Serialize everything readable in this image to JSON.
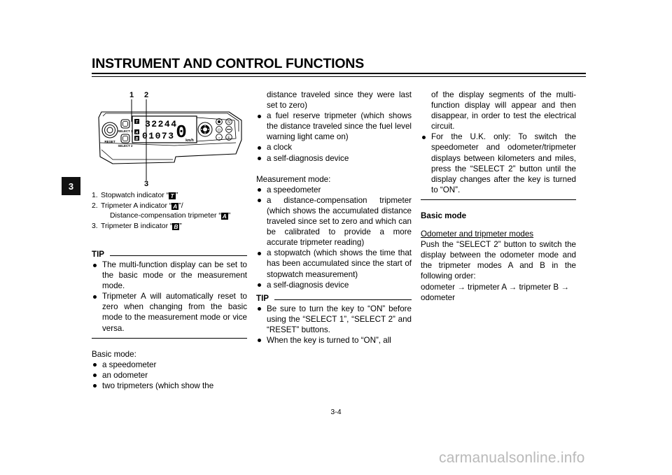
{
  "header": {
    "chapter_title": "INSTRUMENT AND CONTROL FUNCTIONS"
  },
  "margin_tab": {
    "chapter_number": "3"
  },
  "figure": {
    "callouts": [
      "1",
      "2",
      "3"
    ],
    "lcd": {
      "top_value": "32244",
      "bottom_value": "01073",
      "speed_value": "0",
      "speed_unit": "km/h",
      "indicator_top": "T",
      "indicator_mid": "A",
      "indicator_bottom": "B"
    },
    "buttons": {
      "reset_label": "RESET",
      "select1_label": "SELECT 1",
      "select2_label": "SELECT 2"
    }
  },
  "legend": {
    "item1_num": "1.",
    "item1_text_before": "Stopwatch indicator “",
    "item1_glyph": "T",
    "item1_text_after": "”",
    "item2_num": "2.",
    "item2_text_before": "Tripmeter A indicator “",
    "item2_glyph": "A",
    "item2_text_after": "”/",
    "item2_sub_before": "Distance-compensation tripmeter “",
    "item2_sub_glyph": "A",
    "item2_sub_after": "”",
    "item3_num": "3.",
    "item3_text_before": "Tripmeter B indicator “",
    "item3_glyph": "B",
    "item3_text_after": "”"
  },
  "column1": {
    "tip_label": "TIP",
    "tip_bullets": [
      "The multi-function display can be set to the basic mode or the measurement mode.",
      "Tripmeter A will automatically reset to zero when changing from the basic mode to the measurement mode or vice versa."
    ],
    "basic_mode_heading": "Basic mode:",
    "basic_mode_bullets": [
      "a speedometer",
      "an odometer",
      "two tripmeters (which show the"
    ]
  },
  "column2": {
    "continued_text": "distance traveled since they were last set to zero)",
    "bullets_top": [
      "a fuel reserve tripmeter (which shows the distance traveled since the fuel level warning light came on)",
      "a clock",
      "a self-diagnosis device"
    ],
    "measurement_mode_heading": "Measurement mode:",
    "measurement_bullets": [
      "a speedometer",
      "a distance-compensation tripmeter (which shows the accumulated distance traveled since set to zero and which can be calibrated to provide a more accurate tripmeter reading)",
      "a stopwatch (which shows the time that has been accumulated since the start of stopwatch measurement)",
      "a self-diagnosis device"
    ],
    "tip_label": "TIP",
    "tip_bullets": [
      "Be sure to turn the key to “ON” before using the “SELECT 1”, “SELECT 2” and “RESET” buttons.",
      "When the key is turned to “ON”, all"
    ]
  },
  "column3": {
    "continued_text": "of the display segments of the multi-function display will appear and then disappear, in order to test the electrical circuit.",
    "tip_bullets": [
      "For the U.K. only: To switch the speedometer and odometer/tripmeter displays between kilometers and miles, press the “SELECT 2” button until the display changes after the key is turned to “ON”."
    ],
    "basic_mode_heading": "Basic mode",
    "odometer_heading": "Odometer and tripmeter modes",
    "odometer_body": "Push the “SELECT 2” button to switch the display between the odometer mode and the tripmeter modes A and B in the following order:",
    "odometer_order": "odometer → tripmeter A → tripmeter B → odometer"
  },
  "footer": {
    "page_number": "3-4",
    "watermark": "carmanualsonline.info"
  }
}
